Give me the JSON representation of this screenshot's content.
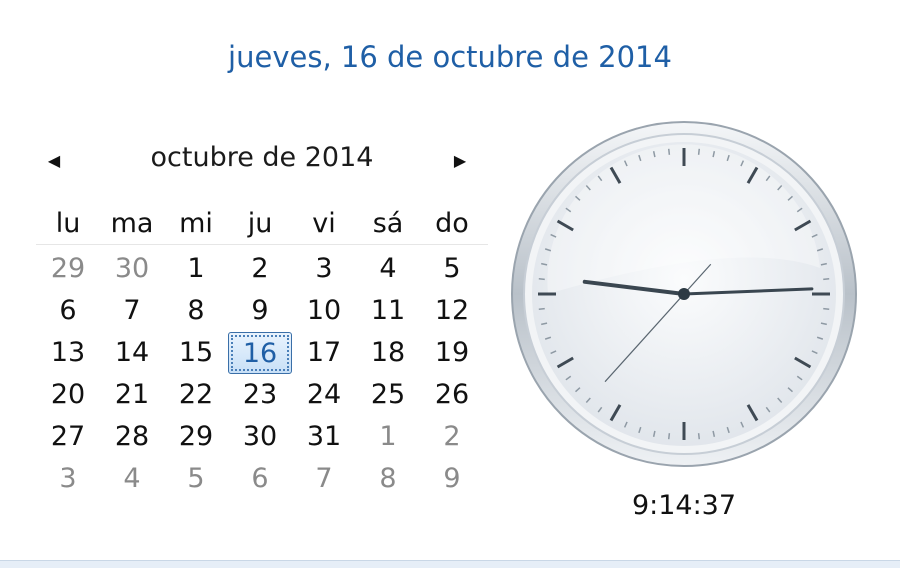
{
  "header": {
    "long_date": "jueves, 16 de octubre de 2014"
  },
  "calendar": {
    "month_title": "octubre de 2014",
    "prev_icon": "triangle-left-icon",
    "next_icon": "triangle-right-icon",
    "weekdays": [
      "lu",
      "ma",
      "mi",
      "ju",
      "vi",
      "sá",
      "do"
    ],
    "weeks": [
      [
        {
          "d": "29",
          "o": true
        },
        {
          "d": "30",
          "o": true
        },
        {
          "d": "1"
        },
        {
          "d": "2"
        },
        {
          "d": "3"
        },
        {
          "d": "4"
        },
        {
          "d": "5"
        }
      ],
      [
        {
          "d": "6"
        },
        {
          "d": "7"
        },
        {
          "d": "8"
        },
        {
          "d": "9"
        },
        {
          "d": "10"
        },
        {
          "d": "11"
        },
        {
          "d": "12"
        }
      ],
      [
        {
          "d": "13"
        },
        {
          "d": "14"
        },
        {
          "d": "15"
        },
        {
          "d": "16",
          "today": true
        },
        {
          "d": "17"
        },
        {
          "d": "18"
        },
        {
          "d": "19"
        }
      ],
      [
        {
          "d": "20"
        },
        {
          "d": "21"
        },
        {
          "d": "22"
        },
        {
          "d": "23"
        },
        {
          "d": "24"
        },
        {
          "d": "25"
        },
        {
          "d": "26"
        }
      ],
      [
        {
          "d": "27"
        },
        {
          "d": "28"
        },
        {
          "d": "29"
        },
        {
          "d": "30"
        },
        {
          "d": "31"
        },
        {
          "d": "1",
          "o": true
        },
        {
          "d": "2",
          "o": true
        }
      ],
      [
        {
          "d": "3",
          "o": true
        },
        {
          "d": "4",
          "o": true
        },
        {
          "d": "5",
          "o": true
        },
        {
          "d": "6",
          "o": true
        },
        {
          "d": "7",
          "o": true
        },
        {
          "d": "8",
          "o": true
        },
        {
          "d": "9",
          "o": true
        }
      ]
    ],
    "colors": {
      "today_text": "#1f5fa6",
      "other_month_text": "#8a8a8a"
    }
  },
  "clock": {
    "time_text": "9:14:37",
    "hours": 9,
    "minutes": 14,
    "seconds": 37
  },
  "colors": {
    "accent": "#1f5fa6"
  }
}
